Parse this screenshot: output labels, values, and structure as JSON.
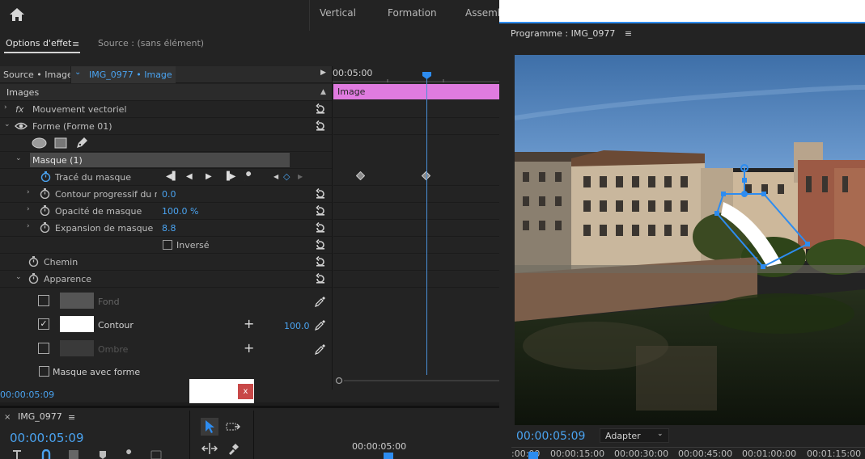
{
  "workspace_tabs": [
    "Vertical",
    "Formation",
    "Assembl"
  ],
  "effect_panel": {
    "tab_active": "Options d'effet",
    "tab_menu": "≡",
    "tab_inactive": "Source : (sans élément)",
    "source_label": "Source • Image",
    "clip_label": "IMG_0977 • Image",
    "section_header": "Images",
    "rows": {
      "motion": "Mouvement vectoriel",
      "shape": "Forme (Forme 01)",
      "mask": "Masque (1)",
      "mask_path": "Tracé du masque",
      "feather": "Contour progressif du m...",
      "feather_value": "0.0",
      "opacity": "Opacité de masque",
      "opacity_value": "100.0 %",
      "expansion": "Expansion de masque",
      "expansion_value": "8.8",
      "inverted": "Inversé",
      "path": "Chemin",
      "appearance": "Apparence",
      "fill": "Fond",
      "stroke": "Contour",
      "stroke_value": "100.0",
      "shadow": "Ombre",
      "mask_from_shape": "Masque avec forme"
    },
    "fx_glyph": "fx",
    "timeline_time": "00:05:00",
    "clip_bar_label": "Image",
    "current_time": "00:00:05:09",
    "close_glyph": "x"
  },
  "sequence": {
    "close_glyph": "×",
    "name": "IMG_0977",
    "menu": "≡",
    "timecode": "00:00:05:09",
    "ruler_time": "00:00:05:00"
  },
  "program": {
    "title": "Programme : IMG_0977",
    "menu": "≡",
    "timecode": "00:00:05:09",
    "fit_label": "Adapter",
    "ruler_ticks": [
      ":00:00",
      "00:00:15:00",
      "00:00:30:00",
      "00:00:45:00",
      "00:01:00:00",
      "00:01:15:00"
    ]
  },
  "colors": {
    "accent": "#2d8cf0",
    "clip": "#e07be0",
    "close": "#c84848"
  },
  "icons": [
    "home-icon",
    "fx-icon",
    "eye-icon",
    "ellipse-icon",
    "rectangle-icon",
    "pen-icon",
    "stopwatch-icon",
    "reset-icon",
    "eyedropper-icon",
    "plus-icon",
    "wrench-icon",
    "selection-tool-icon",
    "track-select-icon",
    "ripple-edit-icon",
    "razor-icon"
  ]
}
